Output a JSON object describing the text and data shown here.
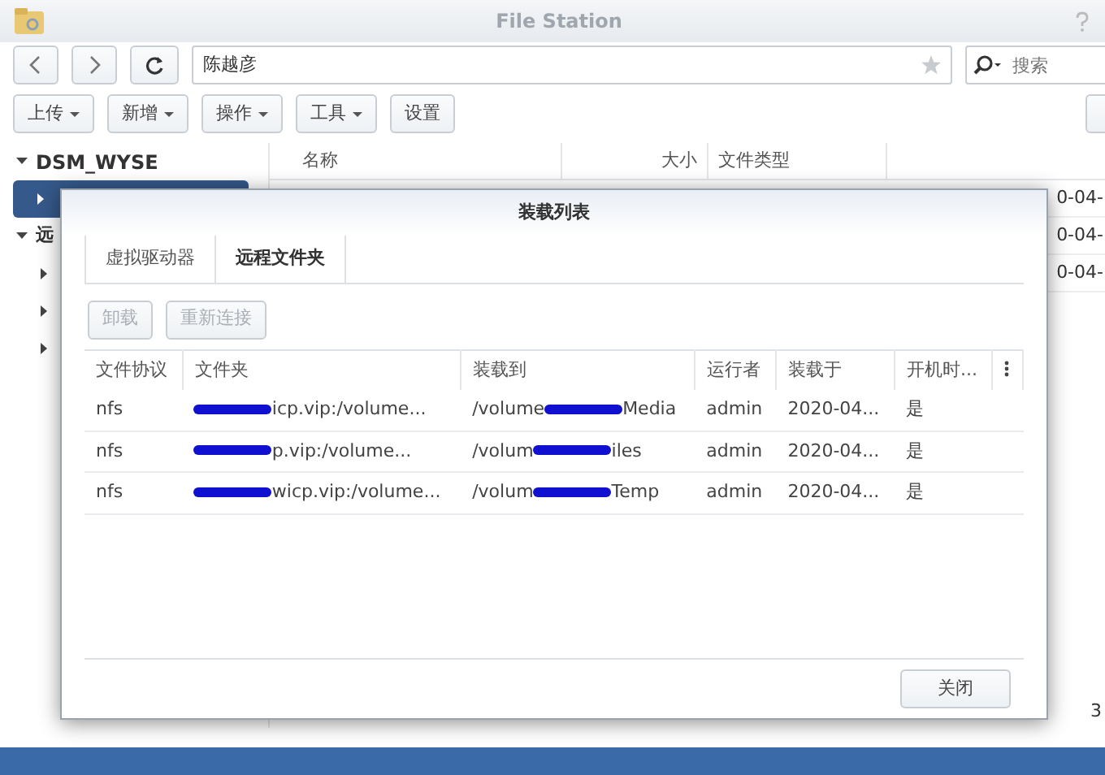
{
  "window": {
    "title": "File Station"
  },
  "toolbar": {
    "path": "陈越彦",
    "search_placeholder": "搜索"
  },
  "actions": [
    {
      "label": "上传",
      "dropdown": true
    },
    {
      "label": "新增",
      "dropdown": true
    },
    {
      "label": "操作",
      "dropdown": true
    },
    {
      "label": "工具",
      "dropdown": true
    },
    {
      "label": "设置",
      "dropdown": false
    }
  ],
  "sidebar": {
    "items": [
      {
        "label": "DSM_WYSE",
        "expanded": true,
        "children": [
          {
            "selected": true
          }
        ]
      },
      {
        "label": "远",
        "expanded": true,
        "children": [
          {
            "selected": false
          },
          {
            "selected": false
          },
          {
            "selected": false
          }
        ]
      }
    ]
  },
  "file_list": {
    "columns": [
      "名称",
      "大小",
      "文件类型"
    ],
    "column_4_cells": [
      "0-04-",
      "0-04-",
      "0-04-"
    ],
    "footer_count": "3"
  },
  "dialog": {
    "title": "装载列表",
    "tabs": [
      {
        "label": "虚拟驱动器",
        "selected": false
      },
      {
        "label": "远程文件夹",
        "selected": true
      }
    ],
    "buttons": [
      {
        "label": "卸载",
        "disabled": true
      },
      {
        "label": "重新连接",
        "disabled": true
      }
    ],
    "table": {
      "columns": [
        "文件协议",
        "文件夹",
        "装载到",
        "运行者",
        "装载于",
        "开机时..."
      ],
      "rows": [
        {
          "protocol": "nfs",
          "folder": "icp.vip:/volume...",
          "mount_to": {
            "before": "/volume",
            "after": "Media"
          },
          "runner": "admin",
          "mounted_at": "2020-04...",
          "on_boot": "是"
        },
        {
          "protocol": "nfs",
          "folder": "p.vip:/volume...",
          "mount_to": {
            "before": "/volum",
            "after": "iles"
          },
          "runner": "admin",
          "mounted_at": "2020-04...",
          "on_boot": "是"
        },
        {
          "protocol": "nfs",
          "folder": "wicp.vip:/volume...",
          "mount_to": {
            "before": "/volum",
            "after": "Temp"
          },
          "runner": "admin",
          "mounted_at": "2020-04...",
          "on_boot": "是"
        }
      ]
    },
    "close_button": "关闭"
  }
}
